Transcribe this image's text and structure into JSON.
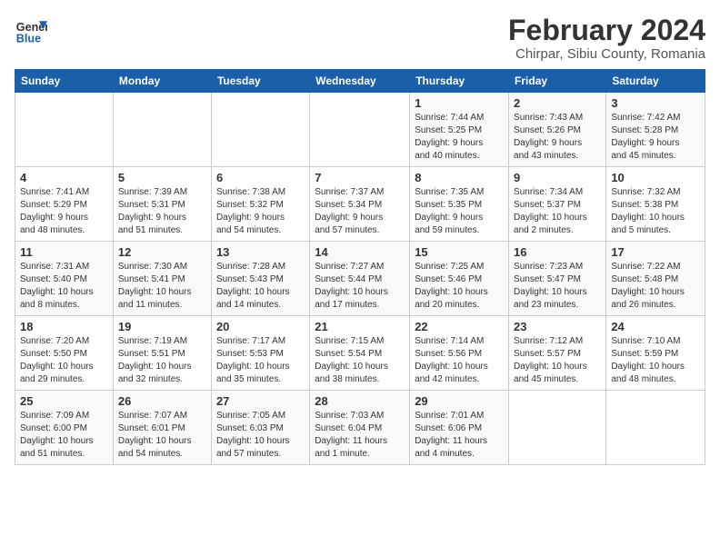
{
  "logo": {
    "text_general": "General",
    "text_blue": "Blue"
  },
  "title": "February 2024",
  "subtitle": "Chirpar, Sibiu County, Romania",
  "header_days": [
    "Sunday",
    "Monday",
    "Tuesday",
    "Wednesday",
    "Thursday",
    "Friday",
    "Saturday"
  ],
  "weeks": [
    [
      {
        "day": "",
        "info": ""
      },
      {
        "day": "",
        "info": ""
      },
      {
        "day": "",
        "info": ""
      },
      {
        "day": "",
        "info": ""
      },
      {
        "day": "1",
        "info": "Sunrise: 7:44 AM\nSunset: 5:25 PM\nDaylight: 9 hours\nand 40 minutes."
      },
      {
        "day": "2",
        "info": "Sunrise: 7:43 AM\nSunset: 5:26 PM\nDaylight: 9 hours\nand 43 minutes."
      },
      {
        "day": "3",
        "info": "Sunrise: 7:42 AM\nSunset: 5:28 PM\nDaylight: 9 hours\nand 45 minutes."
      }
    ],
    [
      {
        "day": "4",
        "info": "Sunrise: 7:41 AM\nSunset: 5:29 PM\nDaylight: 9 hours\nand 48 minutes."
      },
      {
        "day": "5",
        "info": "Sunrise: 7:39 AM\nSunset: 5:31 PM\nDaylight: 9 hours\nand 51 minutes."
      },
      {
        "day": "6",
        "info": "Sunrise: 7:38 AM\nSunset: 5:32 PM\nDaylight: 9 hours\nand 54 minutes."
      },
      {
        "day": "7",
        "info": "Sunrise: 7:37 AM\nSunset: 5:34 PM\nDaylight: 9 hours\nand 57 minutes."
      },
      {
        "day": "8",
        "info": "Sunrise: 7:35 AM\nSunset: 5:35 PM\nDaylight: 9 hours\nand 59 minutes."
      },
      {
        "day": "9",
        "info": "Sunrise: 7:34 AM\nSunset: 5:37 PM\nDaylight: 10 hours\nand 2 minutes."
      },
      {
        "day": "10",
        "info": "Sunrise: 7:32 AM\nSunset: 5:38 PM\nDaylight: 10 hours\nand 5 minutes."
      }
    ],
    [
      {
        "day": "11",
        "info": "Sunrise: 7:31 AM\nSunset: 5:40 PM\nDaylight: 10 hours\nand 8 minutes."
      },
      {
        "day": "12",
        "info": "Sunrise: 7:30 AM\nSunset: 5:41 PM\nDaylight: 10 hours\nand 11 minutes."
      },
      {
        "day": "13",
        "info": "Sunrise: 7:28 AM\nSunset: 5:43 PM\nDaylight: 10 hours\nand 14 minutes."
      },
      {
        "day": "14",
        "info": "Sunrise: 7:27 AM\nSunset: 5:44 PM\nDaylight: 10 hours\nand 17 minutes."
      },
      {
        "day": "15",
        "info": "Sunrise: 7:25 AM\nSunset: 5:46 PM\nDaylight: 10 hours\nand 20 minutes."
      },
      {
        "day": "16",
        "info": "Sunrise: 7:23 AM\nSunset: 5:47 PM\nDaylight: 10 hours\nand 23 minutes."
      },
      {
        "day": "17",
        "info": "Sunrise: 7:22 AM\nSunset: 5:48 PM\nDaylight: 10 hours\nand 26 minutes."
      }
    ],
    [
      {
        "day": "18",
        "info": "Sunrise: 7:20 AM\nSunset: 5:50 PM\nDaylight: 10 hours\nand 29 minutes."
      },
      {
        "day": "19",
        "info": "Sunrise: 7:19 AM\nSunset: 5:51 PM\nDaylight: 10 hours\nand 32 minutes."
      },
      {
        "day": "20",
        "info": "Sunrise: 7:17 AM\nSunset: 5:53 PM\nDaylight: 10 hours\nand 35 minutes."
      },
      {
        "day": "21",
        "info": "Sunrise: 7:15 AM\nSunset: 5:54 PM\nDaylight: 10 hours\nand 38 minutes."
      },
      {
        "day": "22",
        "info": "Sunrise: 7:14 AM\nSunset: 5:56 PM\nDaylight: 10 hours\nand 42 minutes."
      },
      {
        "day": "23",
        "info": "Sunrise: 7:12 AM\nSunset: 5:57 PM\nDaylight: 10 hours\nand 45 minutes."
      },
      {
        "day": "24",
        "info": "Sunrise: 7:10 AM\nSunset: 5:59 PM\nDaylight: 10 hours\nand 48 minutes."
      }
    ],
    [
      {
        "day": "25",
        "info": "Sunrise: 7:09 AM\nSunset: 6:00 PM\nDaylight: 10 hours\nand 51 minutes."
      },
      {
        "day": "26",
        "info": "Sunrise: 7:07 AM\nSunset: 6:01 PM\nDaylight: 10 hours\nand 54 minutes."
      },
      {
        "day": "27",
        "info": "Sunrise: 7:05 AM\nSunset: 6:03 PM\nDaylight: 10 hours\nand 57 minutes."
      },
      {
        "day": "28",
        "info": "Sunrise: 7:03 AM\nSunset: 6:04 PM\nDaylight: 11 hours\nand 1 minute."
      },
      {
        "day": "29",
        "info": "Sunrise: 7:01 AM\nSunset: 6:06 PM\nDaylight: 11 hours\nand 4 minutes."
      },
      {
        "day": "",
        "info": ""
      },
      {
        "day": "",
        "info": ""
      }
    ]
  ]
}
